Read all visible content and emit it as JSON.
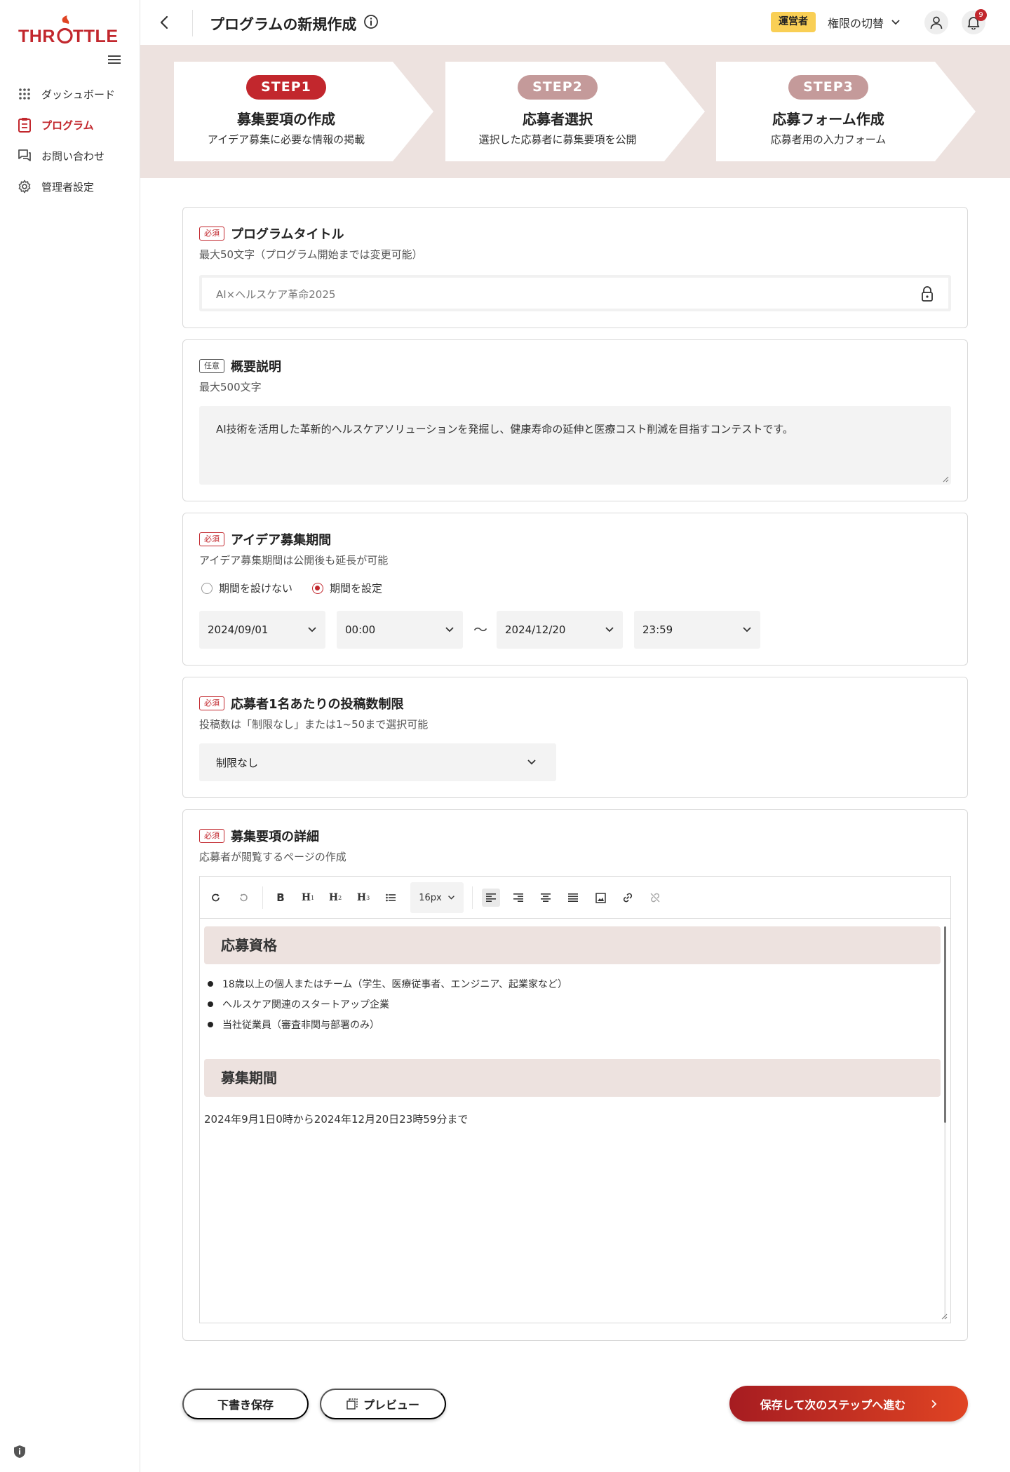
{
  "brand": {
    "logo_text": "THROTTLE",
    "accent": "#c2272d"
  },
  "sidebar": {
    "items": [
      {
        "label": "ダッシュボード",
        "icon": "grid-icon"
      },
      {
        "label": "プログラム",
        "icon": "clipboard-icon",
        "active": true
      },
      {
        "label": "お問い合わせ",
        "icon": "chat-icon"
      },
      {
        "label": "管理者設定",
        "icon": "gear-icon"
      }
    ]
  },
  "header": {
    "title": "プログラムの新規作成",
    "role_badge": "運営者",
    "switch_label": "権限の切替",
    "notification_count": "9"
  },
  "steps": [
    {
      "pill": "STEP1",
      "title": "募集要項の作成",
      "desc": "アイデア募集に必要な情報の掲載",
      "active": true
    },
    {
      "pill": "STEP2",
      "title": "応募者選択",
      "desc": "選択した応募者に募集要項を公開",
      "active": false
    },
    {
      "pill": "STEP3",
      "title": "応募フォーム作成",
      "desc": "応募者用の入力フォーム",
      "active": false
    }
  ],
  "tags": {
    "required": "必須",
    "optional": "任意"
  },
  "program_title": {
    "label": "プログラムタイトル",
    "hint": "最大50文字（プログラム開始までは変更可能）",
    "value": "AI×ヘルスケア革命2025"
  },
  "overview": {
    "label": "概要説明",
    "hint": "最大500文字",
    "value": "AI技術を活用した革新的ヘルスケアソリューションを発掘し、健康寿命の延伸と医療コスト削減を目指すコンテストです。"
  },
  "period": {
    "label": "アイデア募集期間",
    "hint": "アイデア募集期間は公開後も延長が可能",
    "option_none": "期間を設けない",
    "option_set": "期間を設定",
    "selected": "期間を設定",
    "start_date": "2024/09/01",
    "start_time": "00:00",
    "separator": "〜",
    "end_date": "2024/12/20",
    "end_time": "23:59"
  },
  "post_limit": {
    "label": "応募者1名あたりの投稿数制限",
    "hint": "投稿数は「制限なし」または1~50まで選択可能",
    "value": "制限なし"
  },
  "details": {
    "label": "募集要項の詳細",
    "hint": "応募者が閲覧するページの作成",
    "toolbar": {
      "bold": "B",
      "h1": "H",
      "h2": "H",
      "h3": "H",
      "h1_sub": "1",
      "h2_sub": "2",
      "h3_sub": "3",
      "font_size": "16px"
    },
    "content": {
      "heading1": "応募資格",
      "items": [
        "18歳以上の個人またはチーム（学生、医療従事者、エンジニア、起業家など）",
        "ヘルスケア関連のスタートアップ企業",
        "当社従業員（審査非関与部署のみ）"
      ],
      "heading2": "募集期間",
      "paragraph": "2024年9月1日0時から2024年12月20日23時59分まで"
    }
  },
  "actions": {
    "draft": "下書き保存",
    "preview": "プレビュー",
    "next": "保存して次のステップへ進む"
  }
}
